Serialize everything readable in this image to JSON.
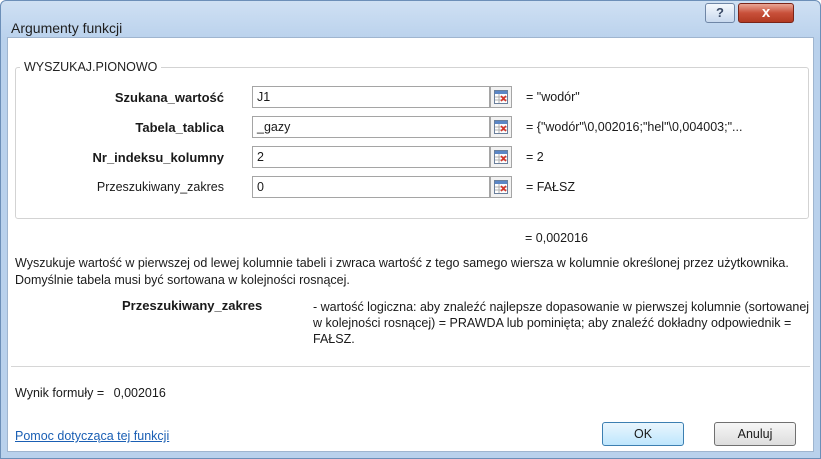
{
  "window": {
    "title": "Argumenty funkcji",
    "help_button": "?",
    "close_button": "x"
  },
  "function": {
    "name": "WYSZUKAJ.PIONOWO",
    "args": [
      {
        "label": "Szukana_wartość",
        "value": "J1",
        "result": "=  \"wodór\"",
        "bold": true
      },
      {
        "label": "Tabela_tablica",
        "value": "_gazy",
        "result": "=  {\"wodór\"\\0,002016;\"hel\"\\0,004003;\"...",
        "bold": true
      },
      {
        "label": "Nr_indeksu_kolumny",
        "value": "2",
        "result": "=  2",
        "bold": true
      },
      {
        "label": "Przeszukiwany_zakres",
        "value": "0",
        "result": "=  FAŁSZ",
        "bold": false
      }
    ],
    "result": "=  0,002016",
    "description": "Wyszukuje wartość w pierwszej od lewej kolumnie tabeli i zwraca wartość z tego samego wiersza w kolumnie określonej przez użytkownika. Domyślnie tabela musi być sortowana w kolejności rosnącej.",
    "arg_help_name": "Przeszukiwany_zakres",
    "arg_help_text": "- wartość logiczna: aby znaleźć najlepsze dopasowanie w pierwszej kolumnie (sortowanej w kolejności rosnącej) = PRAWDA lub pominięta; aby znaleźć dokładny odpowiednik = FAŁSZ."
  },
  "footer": {
    "formula_result_label": "Wynik formuły =",
    "formula_result_value": "0,002016",
    "help_link": "Pomoc dotycząca tej funkcji",
    "ok": "OK",
    "cancel": "Anuluj"
  },
  "icons": {
    "ref_button": "collapse-dialog-icon"
  }
}
